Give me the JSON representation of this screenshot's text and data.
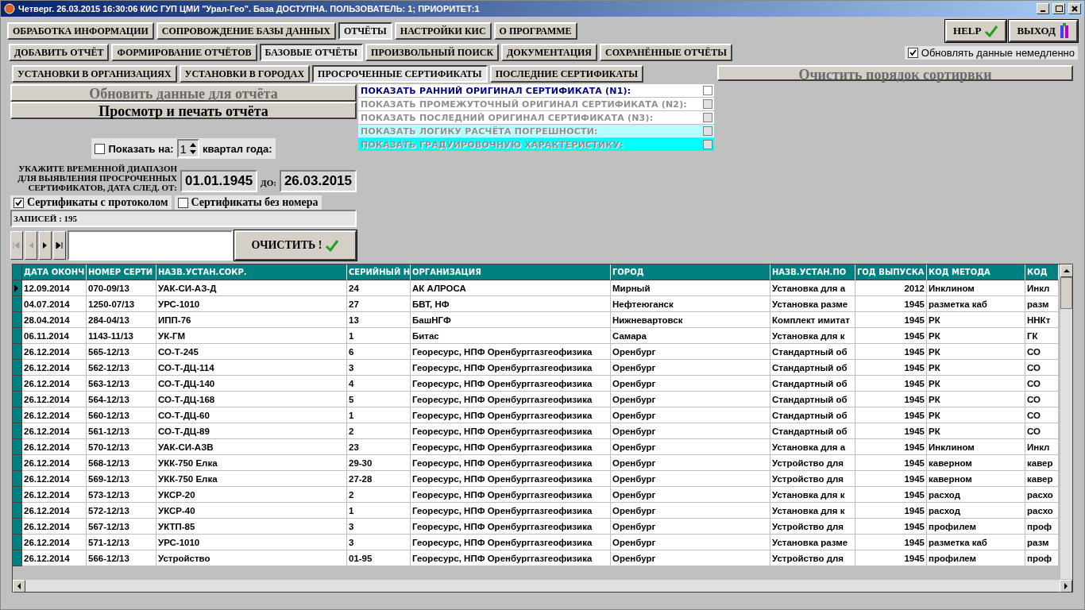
{
  "window": {
    "title": "Четверг. 26.03.2015 16:30:06 КИС ГУП ЦМИ \"Урал-Гео\". База ДОСТУПНА. ПОЛЬЗОВАТЕЛЬ: 1; ПРИОРИТЕТ:1"
  },
  "main_tabs": [
    {
      "label": "ОБРАБОТКА ИНФОРМАЦИИ",
      "selected": false
    },
    {
      "label": "СОПРОВОЖДЕНИЕ БАЗЫ ДАННЫХ",
      "selected": false
    },
    {
      "label": "ОТЧЁТЫ",
      "selected": true
    },
    {
      "label": "НАСТРОЙКИ КИС",
      "selected": false
    },
    {
      "label": "О ПРОГРАММЕ",
      "selected": false
    }
  ],
  "help_button": {
    "label": "HELP"
  },
  "exit_button": {
    "label": "ВЫХОД"
  },
  "report_tabs": [
    {
      "label": "ДОБАВИТЬ ОТЧЁТ",
      "selected": false
    },
    {
      "label": "ФОРМИРОВАНИЕ ОТЧЁТОВ",
      "selected": false
    },
    {
      "label": "БАЗОВЫЕ ОТЧЁТЫ",
      "selected": true
    },
    {
      "label": "ПРОИЗВОЛЬНЫЙ ПОИСК",
      "selected": false
    },
    {
      "label": "ДОКУМЕНТАЦИЯ",
      "selected": false
    },
    {
      "label": "СОХРАНЁННЫЕ ОТЧЁТЫ",
      "selected": false
    }
  ],
  "update_now": {
    "label": "Обновлять данные немедленно",
    "checked": true
  },
  "base_tabs": [
    {
      "label": "УСТАНОВКИ В ОРГАНИЗАЦИЯХ",
      "selected": false
    },
    {
      "label": "УСТАНОВКИ В ГОРОДАХ",
      "selected": false
    },
    {
      "label": "ПРОСРОЧЕННЫЕ СЕРТИФИКАТЫ",
      "selected": true
    },
    {
      "label": "ПОСЛЕДНИЕ СЕРТИФИКАТЫ",
      "selected": false
    }
  ],
  "clear_sort_button": {
    "label": "Очистить порядок сортирвки",
    "disabled": true
  },
  "refresh_button": {
    "label": "Обновить данные для отчёта",
    "disabled": true
  },
  "print_button": {
    "label": "Просмотр и печать отчёта",
    "disabled": false
  },
  "options": [
    {
      "label": "ПОКАЗАТЬ РАННИЙ ОРИГИНАЛ СЕРТИФИКАТА (N1):",
      "checked": false,
      "disabled": false,
      "color": "#ffffff"
    },
    {
      "label": "ПОКАЗАТЬ ПРОМЕЖУТОЧНЫЙ ОРИГИНАЛ СЕРТИФИКАТА (N2):",
      "checked": false,
      "disabled": true,
      "color": "#ffffff"
    },
    {
      "label": "ПОКАЗАТЬ ПОСЛЕДНИЙ ОРИГИНАЛ СЕРТИФИКАТА (N3):",
      "checked": false,
      "disabled": true,
      "color": "#ffffff"
    },
    {
      "label": "ПОКАЗАТЬ ЛОГИКУ РАСЧЁТА ПОГРЕШНОСТИ:",
      "checked": false,
      "disabled": true,
      "color": "#b4ffff"
    },
    {
      "label": "ПОКАЗАТЬ ГРАДУИРОВОЧНУЮ ХАРАКТЕРИСТИКУ:",
      "checked": false,
      "disabled": true,
      "color": "#00ffff"
    }
  ],
  "quarter": {
    "label": "Показать на:",
    "checked": false,
    "value": "1",
    "suffix": "квартал года:"
  },
  "range": {
    "label": "УКАЖИТЕ ВРЕМЕННОЙ ДИАПАЗОН ДЛЯ ВЫЯВЛЕНИЯ ПРОСРОЧЕННЫХ СЕРТИФИКАТОВ, ДАТА СЛЕД. ОТ:",
    "from": "01.01.1945",
    "to_label": "ДО:",
    "to": "26.03.2015"
  },
  "filters": [
    {
      "label": "Сертификаты с протоколом",
      "checked": true
    },
    {
      "label": "Сертификаты без номера",
      "checked": false
    }
  ],
  "records": "ЗАПИСЕЙ : 195",
  "navigator": [
    {
      "kind": "first",
      "disabled": true
    },
    {
      "kind": "prev",
      "disabled": true
    },
    {
      "kind": "next",
      "disabled": false
    },
    {
      "kind": "last",
      "disabled": false
    }
  ],
  "clear_button": {
    "label": "ОЧИСТИТЬ !"
  },
  "table": {
    "columns": [
      "ДАТА ОКОНЧ",
      "НОМЕР СЕРТИ",
      "НАЗВ.УСТАН.СОКР.",
      "СЕРИЙНЫЙ Н",
      "ОРГАНИЗАЦИЯ",
      "ГОРОД",
      "НАЗВ.УСТАН.ПО",
      "ГОД ВЫПУСКА",
      "КОД МЕТОДА",
      "КОД"
    ],
    "rows": [
      {
        "selected": true,
        "cells": [
          "12.09.2014",
          "070-09/13",
          "УАК-СИ-АЗ-Д",
          "24",
          "АК АЛРОСА",
          "Мирный",
          "Установка для а",
          "2012",
          "Инклином",
          "Инкл"
        ]
      },
      {
        "selected": false,
        "cells": [
          "04.07.2014",
          "1250-07/13",
          "УРС-1010",
          "27",
          "БВТ, НФ",
          "Нефтеюганск",
          "Установка разме",
          "1945",
          "разметка каб",
          "разм"
        ]
      },
      {
        "selected": false,
        "cells": [
          "28.04.2014",
          "284-04/13",
          "ИПП-76",
          "13",
          "БашНГФ",
          "Нижневартовск",
          "Комплект имитат",
          "1945",
          "РК",
          "ННКт"
        ]
      },
      {
        "selected": false,
        "cells": [
          "06.11.2014",
          "1143-11/13",
          "УК-ГМ",
          "1",
          "Битас",
          "Самара",
          "Установка для к",
          "1945",
          "РК",
          "ГК"
        ]
      },
      {
        "selected": false,
        "cells": [
          "26.12.2014",
          "565-12/13",
          "СО-Т-245",
          "6",
          "Георесурс, НПФ Оренбурггазгеофизика",
          "Оренбург",
          "Стандартный об",
          "1945",
          "РК",
          "СО"
        ]
      },
      {
        "selected": false,
        "cells": [
          "26.12.2014",
          "562-12/13",
          "СО-Т-ДЦ-114",
          "3",
          "Георесурс, НПФ Оренбурггазгеофизика",
          "Оренбург",
          "Стандартный об",
          "1945",
          "РК",
          "СО"
        ]
      },
      {
        "selected": false,
        "cells": [
          "26.12.2014",
          "563-12/13",
          "СО-Т-ДЦ-140",
          "4",
          "Георесурс, НПФ Оренбурггазгеофизика",
          "Оренбург",
          "Стандартный об",
          "1945",
          "РК",
          "СО"
        ]
      },
      {
        "selected": false,
        "cells": [
          "26.12.2014",
          "564-12/13",
          "СО-Т-ДЦ-168",
          "5",
          "Георесурс, НПФ Оренбурггазгеофизика",
          "Оренбург",
          "Стандартный об",
          "1945",
          "РК",
          "СО"
        ]
      },
      {
        "selected": false,
        "cells": [
          "26.12.2014",
          "560-12/13",
          "СО-Т-ДЦ-60",
          "1",
          "Георесурс, НПФ Оренбурггазгеофизика",
          "Оренбург",
          "Стандартный об",
          "1945",
          "РК",
          "СО"
        ]
      },
      {
        "selected": false,
        "cells": [
          "26.12.2014",
          "561-12/13",
          "СО-Т-ДЦ-89",
          "2",
          "Георесурс, НПФ Оренбурггазгеофизика",
          "Оренбург",
          "Стандартный об",
          "1945",
          "РК",
          "СО"
        ]
      },
      {
        "selected": false,
        "cells": [
          "26.12.2014",
          "570-12/13",
          "УАК-СИ-АЗВ",
          "23",
          "Георесурс, НПФ Оренбурггазгеофизика",
          "Оренбург",
          "Установка для а",
          "1945",
          "Инклином",
          "Инкл"
        ]
      },
      {
        "selected": false,
        "cells": [
          "26.12.2014",
          "568-12/13",
          "УКК-750  Елка",
          "29-30",
          "Георесурс, НПФ Оренбурггазгеофизика",
          "Оренбург",
          "Устройство для",
          "1945",
          "каверном",
          "кавер"
        ]
      },
      {
        "selected": false,
        "cells": [
          "26.12.2014",
          "569-12/13",
          "УКК-750  Елка",
          "27-28",
          "Георесурс, НПФ Оренбурггазгеофизика",
          "Оренбург",
          "Устройство для",
          "1945",
          "каверном",
          "кавер"
        ]
      },
      {
        "selected": false,
        "cells": [
          "26.12.2014",
          "573-12/13",
          "УКСР-20",
          "2",
          "Георесурс, НПФ Оренбурггазгеофизика",
          "Оренбург",
          "Установка для к",
          "1945",
          "расход",
          "расхо"
        ]
      },
      {
        "selected": false,
        "cells": [
          "26.12.2014",
          "572-12/13",
          "УКСР-40",
          "1",
          "Георесурс, НПФ Оренбурггазгеофизика",
          "Оренбург",
          "Установка для к",
          "1945",
          "расход",
          "расхо"
        ]
      },
      {
        "selected": false,
        "cells": [
          "26.12.2014",
          "567-12/13",
          "УКТП-85",
          "3",
          "Георесурс, НПФ Оренбурггазгеофизика",
          "Оренбург",
          "Устройство для",
          "1945",
          "профилем",
          "проф"
        ]
      },
      {
        "selected": false,
        "cells": [
          "26.12.2014",
          "571-12/13",
          "УРС-1010",
          "3",
          "Георесурс, НПФ Оренбурггазгеофизика",
          "Оренбург",
          "Установка разме",
          "1945",
          "разметка каб",
          "разм"
        ]
      },
      {
        "selected": false,
        "cells": [
          "26.12.2014",
          "566-12/13",
          "Устройство",
          "01-95",
          "Георесурс, НПФ Оренбурггазгеофизика",
          "Оренбург",
          "Устройство для",
          "1945",
          "профилем",
          "проф"
        ]
      }
    ]
  }
}
